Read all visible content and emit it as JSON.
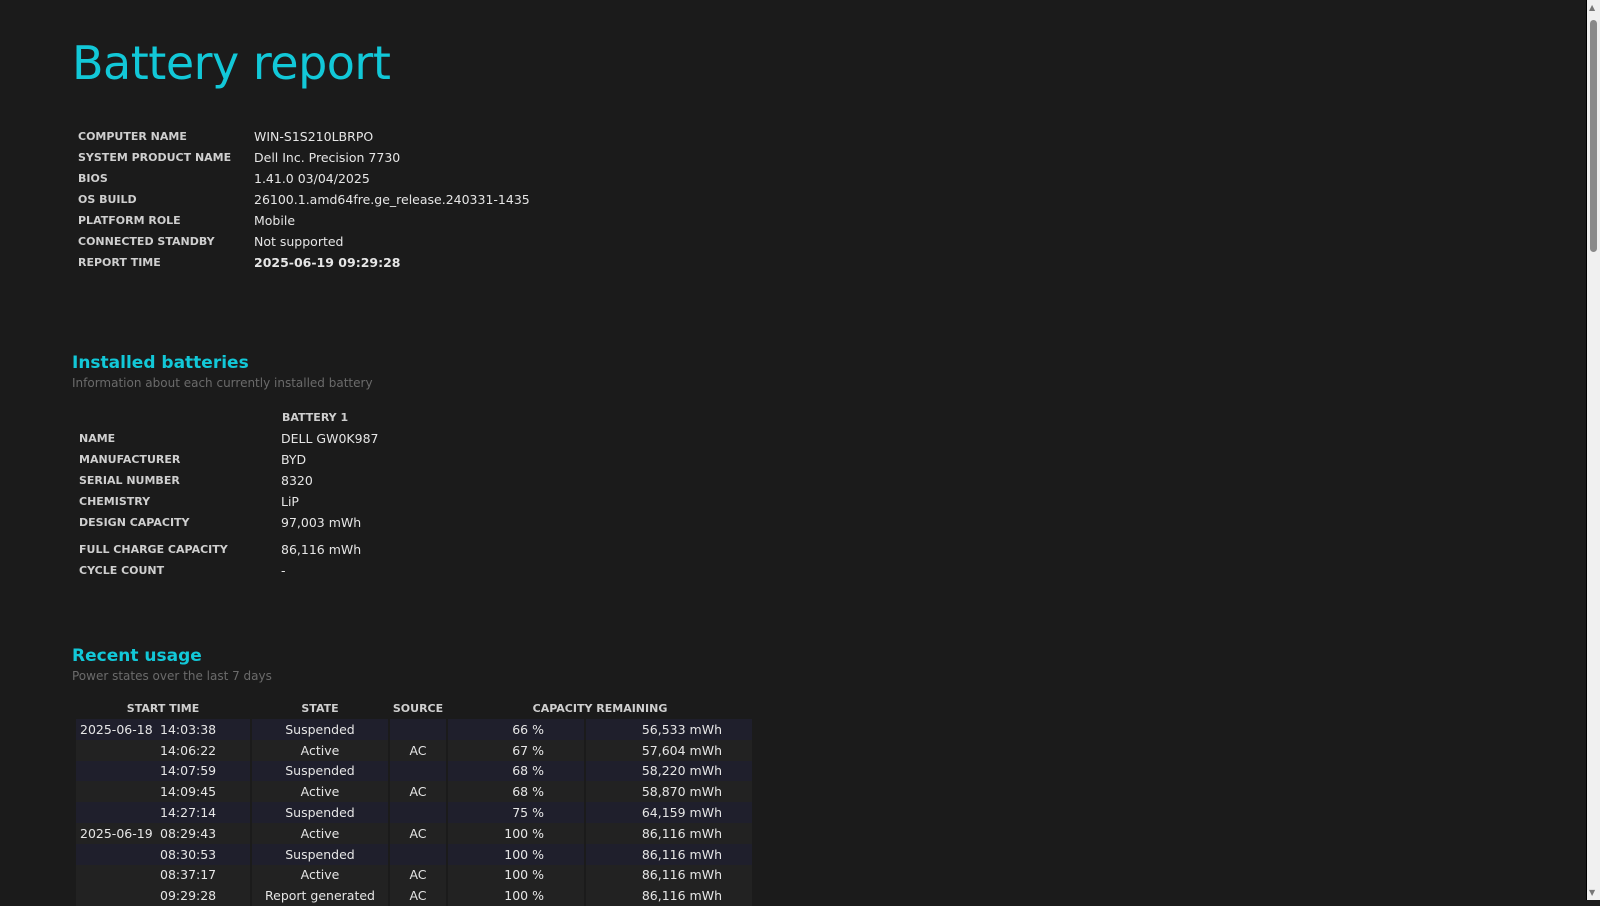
{
  "title": "Battery report",
  "system": [
    {
      "label": "COMPUTER NAME",
      "value": "WIN-S1S210LBRPO"
    },
    {
      "label": "SYSTEM PRODUCT NAME",
      "value": "Dell Inc. Precision 7730"
    },
    {
      "label": "BIOS",
      "value": "1.41.0 03/04/2025"
    },
    {
      "label": "OS BUILD",
      "value": "26100.1.amd64fre.ge_release.240331-1435"
    },
    {
      "label": "PLATFORM ROLE",
      "value": "Mobile"
    },
    {
      "label": "CONNECTED STANDBY",
      "value": "Not supported"
    },
    {
      "label": "REPORT TIME",
      "value": "2025-06-19  09:29:28"
    }
  ],
  "installed": {
    "heading": "Installed batteries",
    "subtitle": "Information about each currently installed battery",
    "column": "BATTERY 1",
    "rows": [
      {
        "label": "NAME",
        "value": "DELL GW0K987"
      },
      {
        "label": "MANUFACTURER",
        "value": "BYD"
      },
      {
        "label": "SERIAL NUMBER",
        "value": "8320"
      },
      {
        "label": "CHEMISTRY",
        "value": "LiP"
      },
      {
        "label": "DESIGN CAPACITY",
        "value": "97,003 mWh"
      },
      {
        "label": "FULL CHARGE CAPACITY",
        "value": "86,116 mWh"
      },
      {
        "label": "CYCLE COUNT",
        "value": "-"
      }
    ]
  },
  "recent": {
    "heading": "Recent usage",
    "subtitle": "Power states over the last 7 days",
    "headers": {
      "start": "START TIME",
      "state": "STATE",
      "source": "SOURCE",
      "capacity": "CAPACITY REMAINING"
    },
    "rows": [
      {
        "date": "2025-06-18",
        "time": "14:03:38",
        "state": "Suspended",
        "source": "",
        "pct": "66 %",
        "mwh": "56,533 mWh"
      },
      {
        "date": "",
        "time": "14:06:22",
        "state": "Active",
        "source": "AC",
        "pct": "67 %",
        "mwh": "57,604 mWh"
      },
      {
        "date": "",
        "time": "14:07:59",
        "state": "Suspended",
        "source": "",
        "pct": "68 %",
        "mwh": "58,220 mWh"
      },
      {
        "date": "",
        "time": "14:09:45",
        "state": "Active",
        "source": "AC",
        "pct": "68 %",
        "mwh": "58,870 mWh"
      },
      {
        "date": "",
        "time": "14:27:14",
        "state": "Suspended",
        "source": "",
        "pct": "75 %",
        "mwh": "64,159 mWh"
      },
      {
        "date": "2025-06-19",
        "time": "08:29:43",
        "state": "Active",
        "source": "AC",
        "pct": "100 %",
        "mwh": "86,116 mWh"
      },
      {
        "date": "",
        "time": "08:30:53",
        "state": "Suspended",
        "source": "",
        "pct": "100 %",
        "mwh": "86,116 mWh"
      },
      {
        "date": "",
        "time": "08:37:17",
        "state": "Active",
        "source": "AC",
        "pct": "100 %",
        "mwh": "86,116 mWh"
      },
      {
        "date": "",
        "time": "09:29:28",
        "state": "Report generated",
        "source": "AC",
        "pct": "100 %",
        "mwh": "86,116 mWh"
      }
    ]
  }
}
